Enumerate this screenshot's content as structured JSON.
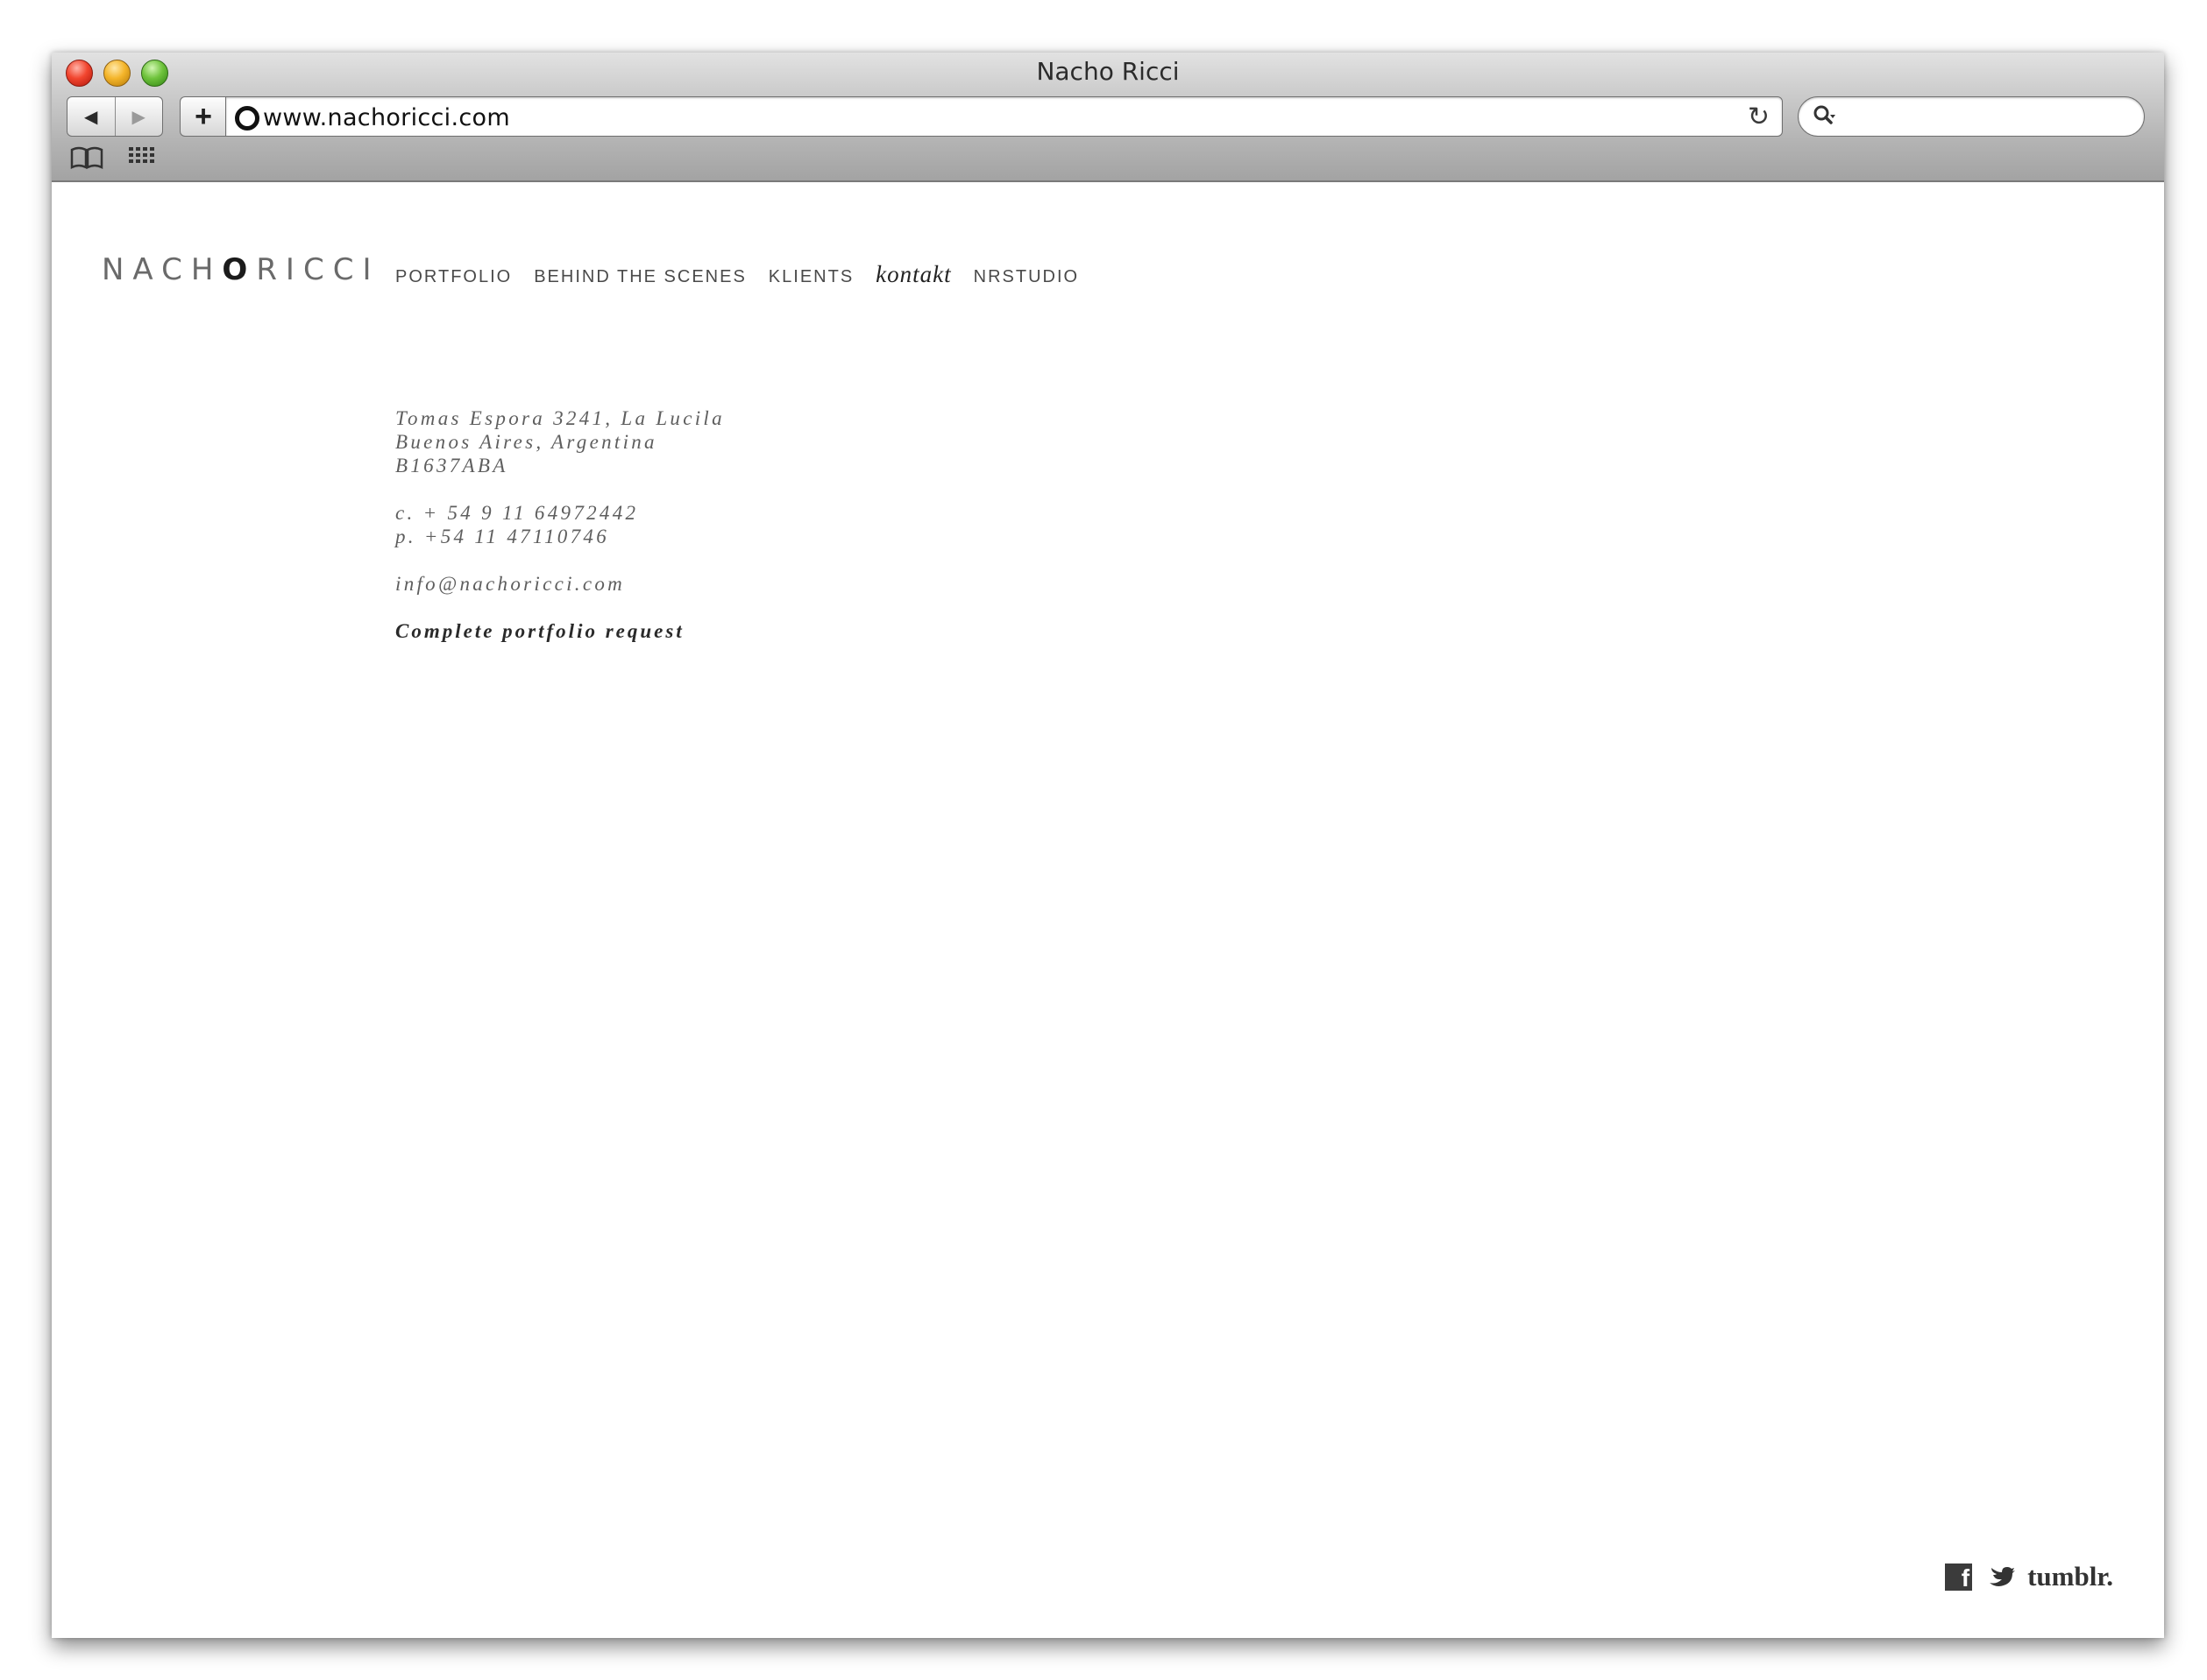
{
  "window": {
    "title": "Nacho Ricci"
  },
  "toolbar": {
    "back_label": "◀",
    "forward_label": "▶",
    "add_label": "+",
    "url": "www.nachoricci.com",
    "reload_label": "↻"
  },
  "site": {
    "logo": {
      "part1": "NACH",
      "part2": "O",
      "part3": "RICCI"
    },
    "nav": [
      {
        "label": "PORTFOLIO"
      },
      {
        "label": "BEHIND THE SCENES"
      },
      {
        "label": "KLIENTS"
      },
      {
        "label": "kontakt",
        "active": true
      },
      {
        "label": "NRSTUDIO"
      }
    ],
    "contact": {
      "address1": "Tomas Espora 3241, La Lucila",
      "address2": "Buenos Aires, Argentina",
      "postal": "B1637ABA",
      "cell": "c. + 54 9 11 64972442",
      "phone": "p. +54 11 47110746",
      "email": "info@nachoricci.com",
      "request": "Complete portfolio request"
    },
    "social": {
      "facebook": "f",
      "tumblr": "tumblr."
    }
  },
  "icons": [
    "close-button",
    "minimize-button",
    "zoom-button",
    "site-icon",
    "reload-icon",
    "search-icon",
    "bookmarks-icon",
    "top-sites-icon",
    "facebook-icon",
    "twitter-icon"
  ]
}
